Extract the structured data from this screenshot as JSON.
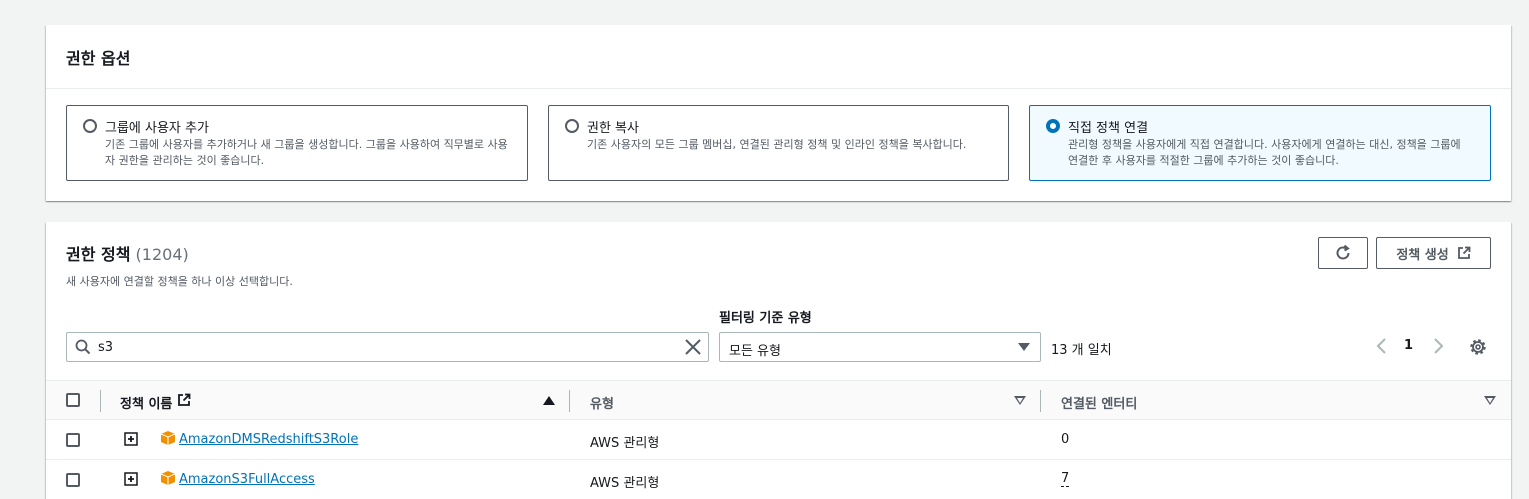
{
  "permission_options": {
    "title": "권한 옵션",
    "options": [
      {
        "label": "그룹에 사용자 추가",
        "description": "기존 그룹에 사용자를 추가하거나 새 그룹을 생성합니다. 그룹을 사용하여 직무별로 사용자 권한을 관리하는 것이 좋습니다.",
        "selected": false
      },
      {
        "label": "권한 복사",
        "description": "기존 사용자의 모든 그룹 멤버십, 연결된 관리형 정책 및 인라인 정책을 복사합니다.",
        "selected": false
      },
      {
        "label": "직접 정책 연결",
        "description": "관리형 정책을 사용자에게 직접 연결합니다. 사용자에게 연결하는 대신, 정책을 그룹에 연결한 후 사용자를 적절한 그룹에 추가하는 것이 좋습니다.",
        "selected": true
      }
    ]
  },
  "permission_policies": {
    "title": "권한 정책",
    "count": "(1204)",
    "description": "새 사용자에 연결할 정책을 하나 이상 선택합니다.",
    "create_button": "정책 생성",
    "search_value": "s3",
    "filter_label": "필터링 기준 유형",
    "filter_value": "모든 유형",
    "match_text": "13 개 일치",
    "page": "1",
    "columns": {
      "name": "정책 이름",
      "type": "유형",
      "entities": "연결된 엔터티"
    },
    "rows": [
      {
        "name": "AmazonDMSRedshiftS3Role",
        "type": "AWS 관리형",
        "entities": "0"
      },
      {
        "name": "AmazonS3FullAccess",
        "type": "AWS 관리형",
        "entities": "7"
      }
    ]
  },
  "colors": {
    "accent": "#0073bb",
    "policy_icon": "#f29100"
  },
  "icons": [
    "search-icon",
    "clear-icon",
    "refresh-icon",
    "external-link-icon",
    "chevron-left-icon",
    "chevron-right-icon",
    "gear-icon",
    "expand-icon",
    "policy-icon"
  ]
}
